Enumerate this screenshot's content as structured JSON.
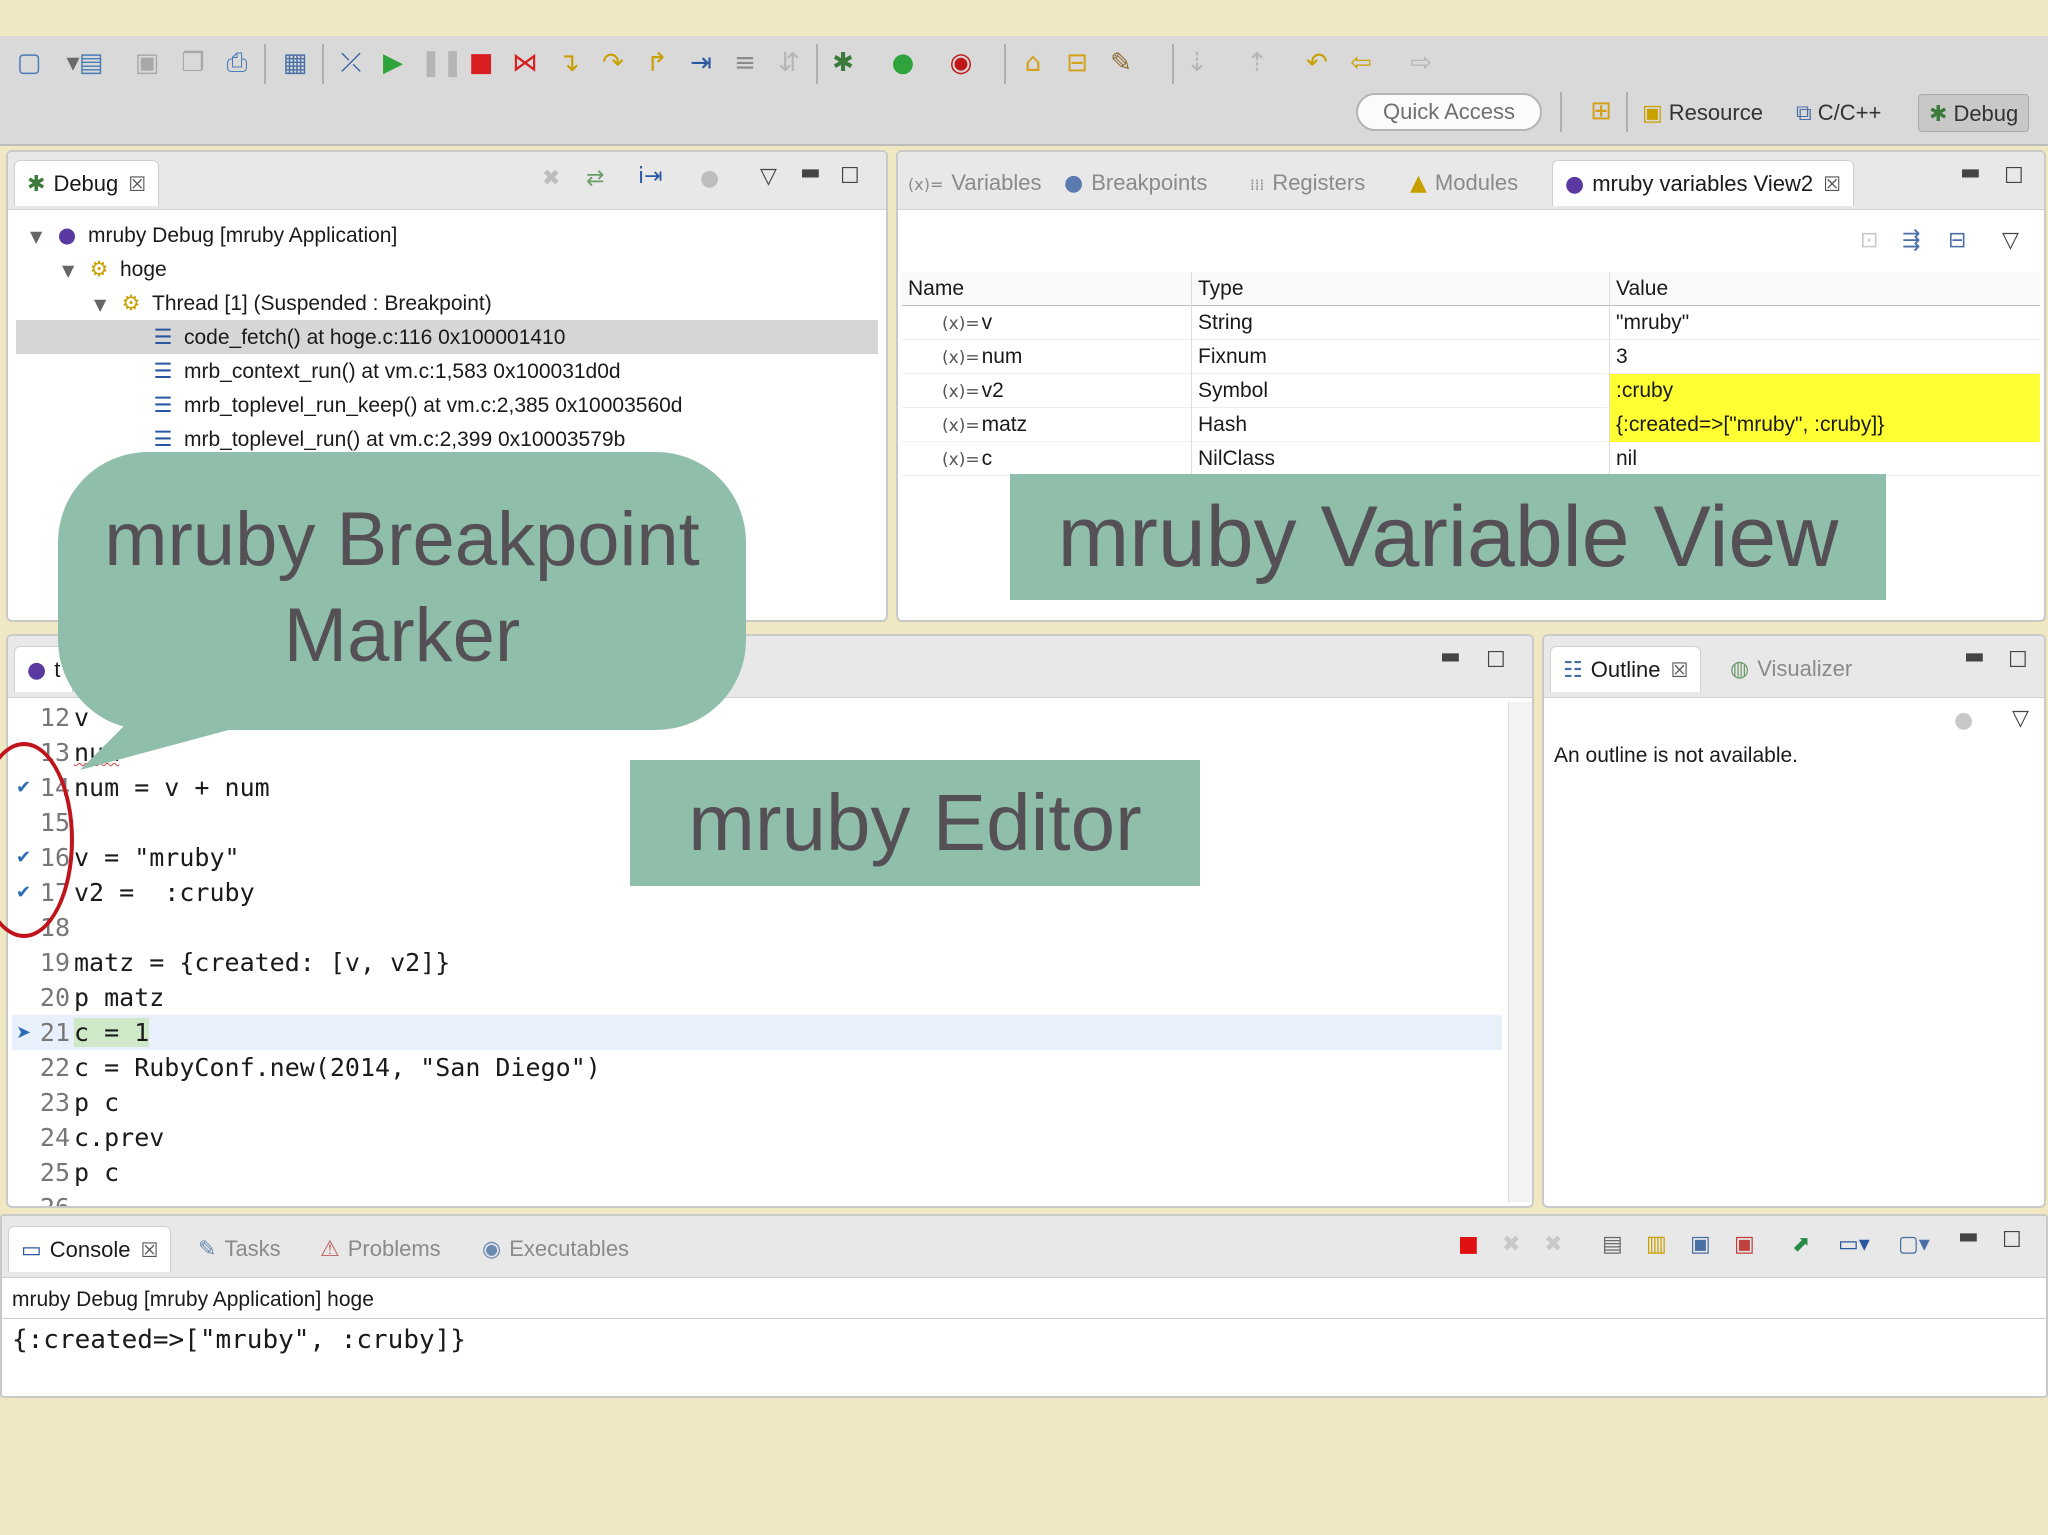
{
  "toolbar": {
    "quick_access": "Quick Access",
    "perspectives": [
      {
        "label": "Resource",
        "icon": "resource-perspective-icon"
      },
      {
        "label": "C/C++",
        "icon": "cpp-perspective-icon"
      },
      {
        "label": "Debug",
        "icon": "debug-perspective-icon"
      }
    ]
  },
  "debug_view": {
    "tab_label": "Debug",
    "tree": [
      {
        "label": "mruby Debug [mruby Application]"
      },
      {
        "label": "hoge"
      },
      {
        "label": "Thread [1] (Suspended : Breakpoint)"
      },
      {
        "label": "code_fetch() at hoge.c:116 0x100001410"
      },
      {
        "label": "mrb_context_run() at vm.c:1,583 0x100031d0d"
      },
      {
        "label": "mrb_toplevel_run_keep() at vm.c:2,385 0x10003560d"
      },
      {
        "label": "mrb_toplevel_run() at vm.c:2,399 0x10003579b"
      }
    ]
  },
  "variables_view": {
    "tabs": [
      "Variables",
      "Breakpoints",
      "Registers",
      "Modules",
      "mruby variables View2"
    ],
    "columns": [
      "Name",
      "Type",
      "Value"
    ],
    "rows": [
      {
        "name": "v",
        "type": "String",
        "value": "\"mruby\""
      },
      {
        "name": "num",
        "type": "Fixnum",
        "value": "3"
      },
      {
        "name": "v2",
        "type": "Symbol",
        "value": ":cruby"
      },
      {
        "name": "matz",
        "type": "Hash",
        "value": "{:created=>[\"mruby\", :cruby]}"
      },
      {
        "name": "c",
        "type": "NilClass",
        "value": "nil"
      }
    ],
    "var_prefix": "(x)=",
    "highlight_color": "#ffff33"
  },
  "editor": {
    "tab_label": "t",
    "lines": [
      {
        "no": "12",
        "code": "v"
      },
      {
        "no": "13",
        "code": "num"
      },
      {
        "no": "14",
        "code": "num = v + num"
      },
      {
        "no": "15",
        "code": ""
      },
      {
        "no": "16",
        "code": "v = \"mruby\""
      },
      {
        "no": "17",
        "code": "v2 =  :cruby"
      },
      {
        "no": "18",
        "code": ""
      },
      {
        "no": "19",
        "code": "matz = {created: [v, v2]}"
      },
      {
        "no": "20",
        "code": "p matz"
      },
      {
        "no": "21",
        "code": "c = 1"
      },
      {
        "no": "22",
        "code": "c = RubyConf.new(2014, \"San Diego\")"
      },
      {
        "no": "23",
        "code": "p c"
      },
      {
        "no": "24",
        "code": "c.prev"
      },
      {
        "no": "25",
        "code": "p c"
      },
      {
        "no": "26",
        "code": ""
      }
    ]
  },
  "outline_view": {
    "tabs": [
      "Outline",
      "Visualizer"
    ],
    "message": "An outline is not available."
  },
  "console_view": {
    "tabs": [
      "Console",
      "Tasks",
      "Problems",
      "Executables"
    ],
    "process_label": "mruby Debug [mruby Application] hoge",
    "output": "{:created=>[\"mruby\", :cruby]}"
  },
  "callouts": {
    "breakpoint_marker": "mruby Breakpoint Marker",
    "variable_view": "mruby Variable View",
    "editor": "mruby Editor",
    "callout_color": "#8fbfaa",
    "circle_color": "#c0141c"
  }
}
